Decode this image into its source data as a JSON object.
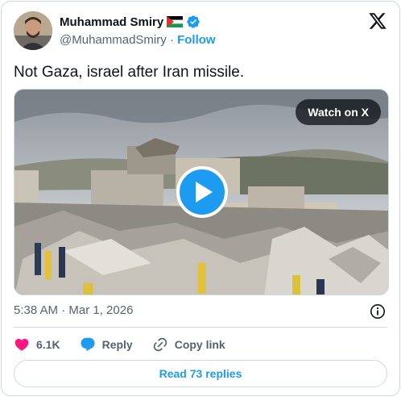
{
  "author": {
    "display_name": "Muhammad Smiry",
    "handle": "@MuhammadSmiry",
    "separator": "·",
    "follow_label": "Follow",
    "verified": true,
    "flag_icon": "palestine-flag-icon"
  },
  "tweet": {
    "text": "Not Gaza, israel after Iran missile."
  },
  "media": {
    "watch_label": "Watch on X",
    "play_icon": "play-icon"
  },
  "meta": {
    "timestamp": "5:38 AM · Mar 1, 2026",
    "info_icon": "info-icon"
  },
  "actions": {
    "likes": "6.1K",
    "reply_label": "Reply",
    "copy_link_label": "Copy link"
  },
  "footer": {
    "read_replies_label": "Read 73 replies"
  },
  "colors": {
    "accent": "#1d9bf0",
    "like": "#f91880",
    "text": "#0f1419",
    "muted": "#536471",
    "border": "#cfd9de"
  }
}
